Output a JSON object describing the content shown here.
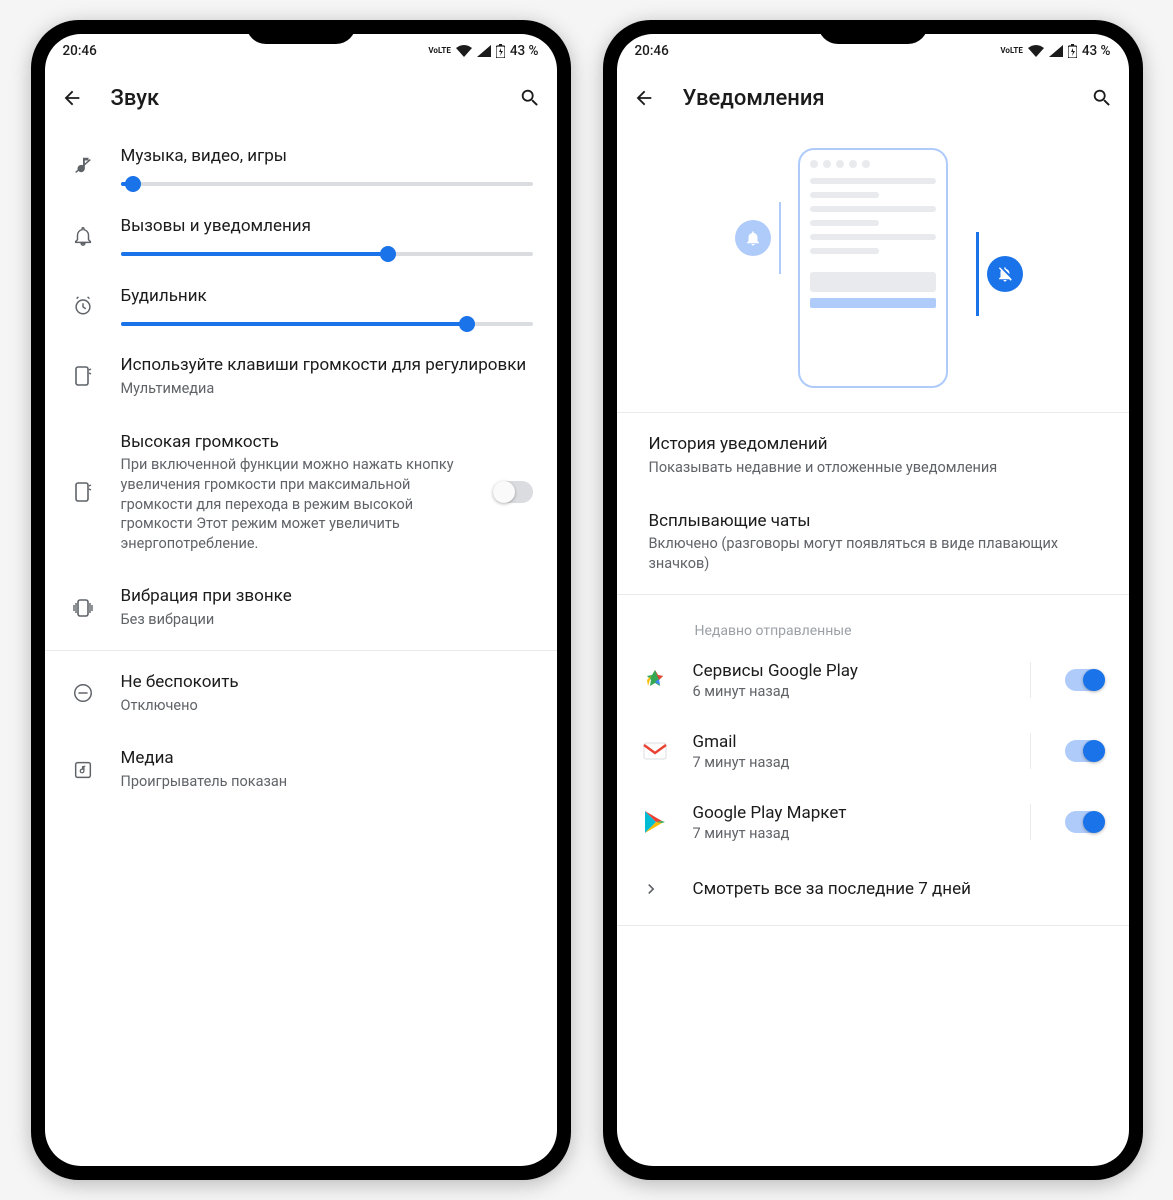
{
  "status": {
    "time": "20:46",
    "battery_text": "43 %",
    "volte": "VoLTE"
  },
  "left": {
    "title": "Звук",
    "sliders": [
      {
        "label": "Музыка, видео, игры",
        "value": 3
      },
      {
        "label": "Вызовы и уведомления",
        "value": 65
      },
      {
        "label": "Будильник",
        "value": 84
      }
    ],
    "volume_keys": {
      "title": "Используйте клавиши громкости для регулировки",
      "sub": "Мультимедиа"
    },
    "extra_volume": {
      "title": "Высокая громкость",
      "sub": "При включенной функции можно нажать кнопку увеличения громкости при максимальной громкости для перехода в режим высокой громкости Этот режим может увеличить энергопотребление.",
      "enabled": false
    },
    "ring_vibrate": {
      "title": "Вибрация при звонке",
      "sub": "Без вибрации"
    },
    "dnd": {
      "title": "Не беспокоить",
      "sub": "Отключено"
    },
    "media": {
      "title": "Медиа",
      "sub": "Проигрыватель показан"
    }
  },
  "right": {
    "title": "Уведомления",
    "history": {
      "title": "История уведомлений",
      "sub": "Показывать недавние и отложенные уведомления"
    },
    "bubbles": {
      "title": "Всплывающие чаты",
      "sub": "Включено (разговоры могут появляться в виде плавающих значков)"
    },
    "recently_sent_label": "Недавно отправленные",
    "apps": [
      {
        "name": "Сервисы Google Play",
        "time": "6 минут назад",
        "enabled": true,
        "color1": "#34a853",
        "color2": "#ea4335"
      },
      {
        "name": "Gmail",
        "time": "7 минут назад",
        "enabled": true,
        "color1": "#ea4335",
        "color2": "#ffffff"
      },
      {
        "name": "Google Play Маркет",
        "time": "7 минут назад",
        "enabled": true,
        "color1": "#00bcd4",
        "color2": "#ea4335"
      }
    ],
    "see_all": "Смотреть все за последние 7 дней"
  }
}
